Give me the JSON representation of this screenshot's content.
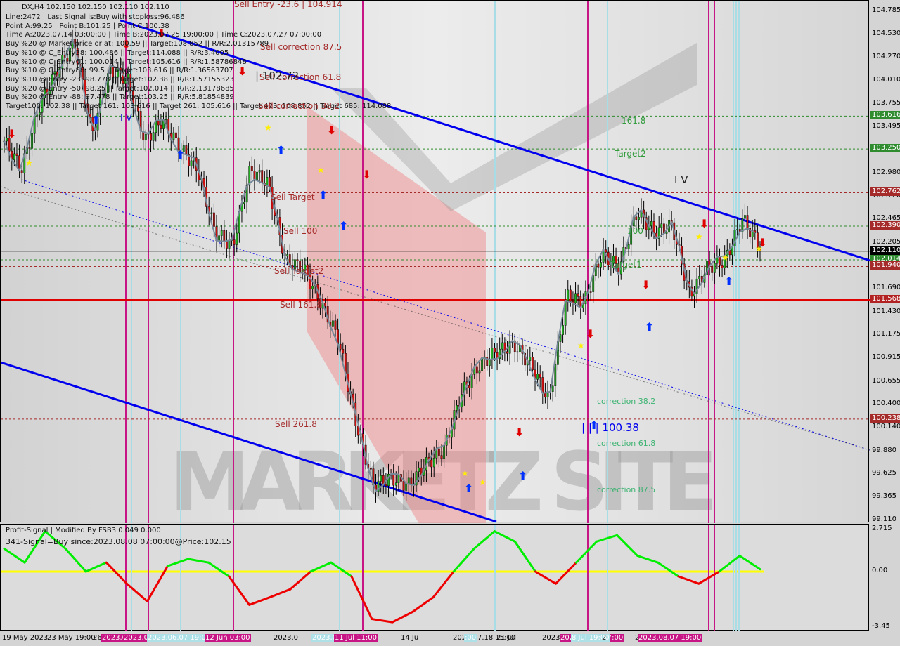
{
  "header": {
    "symbol_line": "DX,H4  102.150 102.150 102.110 102.110"
  },
  "info_lines": [
    "Line:2472 | Last Signal is:Buy with stoploss:96.486",
    "Point A:99.25 | Point B:101.25 | Point C:100.38",
    "Time A:2023.07.14 03:00:00 | Time B:2023.07.25 19:00:00 | Time C:2023.07.27 07:00:00",
    "Buy %20 @ Market price or at: 100.59 || Target:108.852 || R/R:2.01315789",
    "Buy %10 @ C_Entry38: 100.486 || Target:114.088 || R/R:3.4005",
    "Buy %10 @ C_Entry61: 100.014 || Target:105.616 || R/R:1.58786848",
    "Buy %10 @ C_Entry88: 99.5 || Target:103.616 || R/R:1.36563707",
    "Buy %10 @ Entry -23: 98.778 || Target:102.38 || R/R:1.57155323",
    "Buy %20 @ Entry -50: 98.25 || Target:102.014 || R/R:2.13178685",
    "Buy %20 @ Entry -88: 97.478 || Target:103.25 || R/R:5.81854839",
    "Target100: 102.38 || Target 161: 103.616 || Target 261: 105.616 || Target 423: 108.852 || Target 685: 114.088"
  ],
  "chart_labels": {
    "sell_entry": "Sell Entry -23.6 | 104.914",
    "sell_corr_875": "Sell correction 87.5",
    "sell_corr_618": "Sell correction 61.8",
    "wave_price": "| 102.72",
    "sell_corr_382": "Sell correction 38.2",
    "sell_target": "Sell Target",
    "sell_100": "Sell 100",
    "sell_target2": "Sell Target2",
    "sell_1618": "Sell 161.8",
    "sell_2618": "Sell  261.8",
    "buy_1618": "161.8",
    "target2": "Target2",
    "buy_100": "100",
    "target1": "Target1",
    "corr_382": "correction 38.2",
    "corr_618": "correction 61.8",
    "corr_875": "correction 87.5",
    "wave_c": "| | | 100.38",
    "wave_iv": "I V",
    "wave_i": "I",
    "wave_iv2": "I V"
  },
  "watermark": "MARKETZ SITE",
  "price_axis": [
    "104.785",
    "104.530",
    "104.270",
    "104.010",
    "103.755",
    "103.495",
    "102.980",
    "102.720",
    "102.465",
    "102.205",
    "101.690",
    "101.430",
    "101.175",
    "100.915",
    "100.655",
    "100.400",
    "100.140",
    "99.880",
    "99.625",
    "99.365",
    "99.110"
  ],
  "price_tags": [
    {
      "v": "103.616",
      "c": "#2e8b2e"
    },
    {
      "v": "103.250",
      "c": "#2e8b2e"
    },
    {
      "v": "102.762",
      "c": "#a52a2a"
    },
    {
      "v": "102.390",
      "c": "#a52a2a"
    },
    {
      "v": "102.110",
      "c": "#000000"
    },
    {
      "v": "102.014",
      "c": "#2e8b2e"
    },
    {
      "v": "101.940",
      "c": "#a52a2a"
    },
    {
      "v": "101.568",
      "c": "#b22222"
    },
    {
      "v": "100.238",
      "c": "#a52a2a"
    }
  ],
  "oscillator": {
    "title": "Profit-Signal | Modified By FSB3 0.049 0.000",
    "signal": "341-Signal=Buy since:2023.08.08 07:00:00@Price:102.15",
    "axis": [
      "2.715",
      "0.00",
      "-3.45"
    ]
  },
  "time_axis": [
    "19 May 2023",
    "23 May 19:00",
    "26",
    "2023.05.3",
    "2023.06.02 15:00",
    "2023.06.07 19:00",
    "12 Jun 03:00",
    "2023.0",
    "2023.07.06 19:00",
    "11 Jul 11:00",
    "14 Ju",
    "2023.07.18 15:00",
    ":00",
    "21 Jul",
    "2023.0",
    "2023.07.27 07:00",
    "8 Jul 19:00",
    "2",
    "2023.08",
    "2023.08.07 19:00"
  ],
  "chart_data": {
    "type": "candlestick",
    "symbol": "DX",
    "timeframe": "H4",
    "ylim": [
      99.11,
      104.785
    ],
    "close_path": [
      103.337,
      103.024,
      103.728,
      104.12,
      104.433,
      103.415,
      104.12,
      104.041,
      103.337,
      103.572,
      103.259,
      103.024,
      102.319,
      102.163,
      103.024,
      102.867,
      102.006,
      101.928,
      101.537,
      101.145,
      100.206,
      99.501,
      99.58,
      99.501,
      99.736,
      99.893,
      100.519,
      100.832,
      100.989,
      101.067,
      100.832,
      100.441,
      101.615,
      101.537,
      102.084,
      101.928,
      102.554,
      102.319,
      102.397,
      101.615,
      101.928,
      102.006,
      102.475,
      102.163
    ],
    "levels": {
      "green": [
        103.616,
        103.25,
        102.39,
        102.014
      ],
      "red": [
        102.762,
        101.94,
        100.238
      ],
      "solid_red": 101.568,
      "current": 102.11
    },
    "oscillator_values": [
      1.45,
      0.57,
      2.55,
      1.45,
      0,
      0.57,
      -0.75,
      -1.85,
      0.35,
      0.8,
      0.57,
      -0.3,
      -2.07,
      -1.6,
      -1.1,
      0,
      0.57,
      -0.3,
      -2.95,
      -3.15,
      -2.5,
      -1.6,
      0,
      1.45,
      2.55,
      1.9,
      0,
      -0.75,
      0.57,
      1.9,
      2.3,
      1.0,
      0.57,
      -0.3,
      -0.75,
      0,
      1.0,
      0.15
    ],
    "oscillator_ylim": [
      -3.45,
      2.715
    ]
  }
}
